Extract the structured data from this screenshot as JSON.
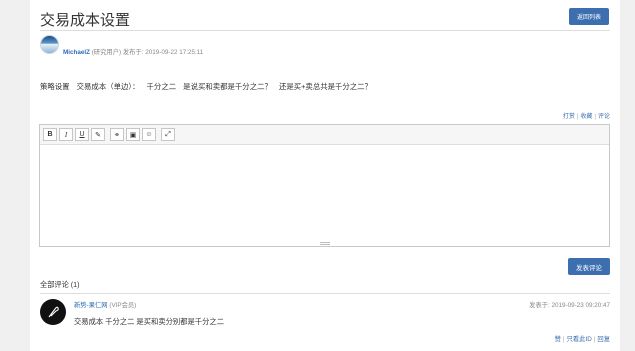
{
  "post": {
    "title": "交易成本设置",
    "back_label": "返回列表",
    "author": "MichaelZ",
    "author_role": "(研究用户)",
    "posted_prefix": "发布于:",
    "posted_time": "2019-09-22 17:25:11",
    "body_parts": [
      "策略设置",
      "交易成本（单边）：",
      "千分之二",
      "是说买和卖都是千分之二？",
      "还是买+卖总共是千分之二？"
    ],
    "actions": [
      "打赏",
      "收藏",
      "评论"
    ]
  },
  "editor": {
    "toolbar": [
      {
        "icon": "bold-icon",
        "glyph": "B"
      },
      {
        "icon": "italic-icon",
        "glyph": "I"
      },
      {
        "icon": "underline-icon",
        "glyph": "U"
      },
      {
        "icon": "clear-format-icon",
        "glyph": "✎"
      },
      {
        "icon": "link-icon",
        "glyph": "⚭"
      },
      {
        "icon": "image-icon",
        "glyph": "▣"
      },
      {
        "icon": "emoji-icon",
        "glyph": "☺"
      },
      {
        "icon": "fullscreen-icon",
        "glyph": "⤢"
      }
    ],
    "submit_label": "发表评论"
  },
  "comments": {
    "heading": "全部评论 (1)",
    "items": [
      {
        "author": "新势-果仁网",
        "role": "(VIP会员)",
        "time": "发表于: 2019-09-23 09:20:47",
        "content": "交易成本 千分之二 是买和卖分别都是千分之二",
        "actions": [
          "赞",
          "只看此ID",
          "回复"
        ]
      }
    ]
  }
}
